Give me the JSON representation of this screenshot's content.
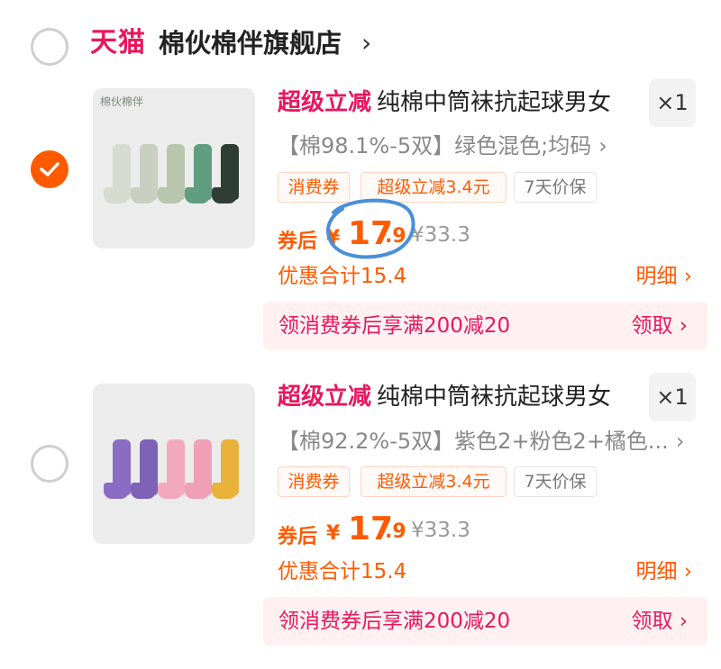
{
  "store": {
    "platform": "天猫",
    "name": "棉伙棉伴旗舰店",
    "chevron": "›"
  },
  "items": [
    {
      "selected": true,
      "thumb_brand": "棉伙棉伴",
      "promo_tag": "超级立减",
      "title": "纯棉中筒袜抗起球男女",
      "quantity": "×1",
      "sku": "【棉98.1%-5双】绿色混色;均码",
      "sku_chevron": "›",
      "tags": [
        "消费券",
        "超级立减3.4元",
        "7天价保"
      ],
      "price_label": "券后",
      "price_yen": "¥",
      "price_int": "17",
      "price_dec": ".9",
      "original_price": "¥33.3",
      "discount_total": "优惠合计15.4",
      "detail_label": "明细 ›",
      "coupon_text": "领消费券后享满200减20",
      "claim_label": "领取 ›",
      "sock_colors": [
        "#d6dbd0",
        "#c9d0c2",
        "#b7c6ad",
        "#5f9c80",
        "#2e3d35"
      ]
    },
    {
      "selected": false,
      "thumb_brand": "",
      "promo_tag": "超级立减",
      "title": "纯棉中筒袜抗起球男女",
      "quantity": "×1",
      "sku": "【棉92.2%-5双】紫色2+粉色2+橘色...",
      "sku_chevron": "›",
      "tags": [
        "消费券",
        "超级立减3.4元",
        "7天价保"
      ],
      "price_label": "券后",
      "price_yen": "¥",
      "price_int": "17",
      "price_dec": ".9",
      "original_price": "¥33.3",
      "discount_total": "优惠合计15.4",
      "detail_label": "明细 ›",
      "coupon_text": "领消费券后享满200减20",
      "claim_label": "领取 ›",
      "sock_colors": [
        "#8a6cc4",
        "#7d62b8",
        "#f2a9bd",
        "#efa0b8",
        "#e9b23a"
      ]
    }
  ],
  "colors": {
    "accent_orange": "#ff5a00",
    "tmall_red": "#e8175d",
    "coupon_bar_bg": "#fff1f2",
    "scribble_blue": "#4a8fd8"
  }
}
